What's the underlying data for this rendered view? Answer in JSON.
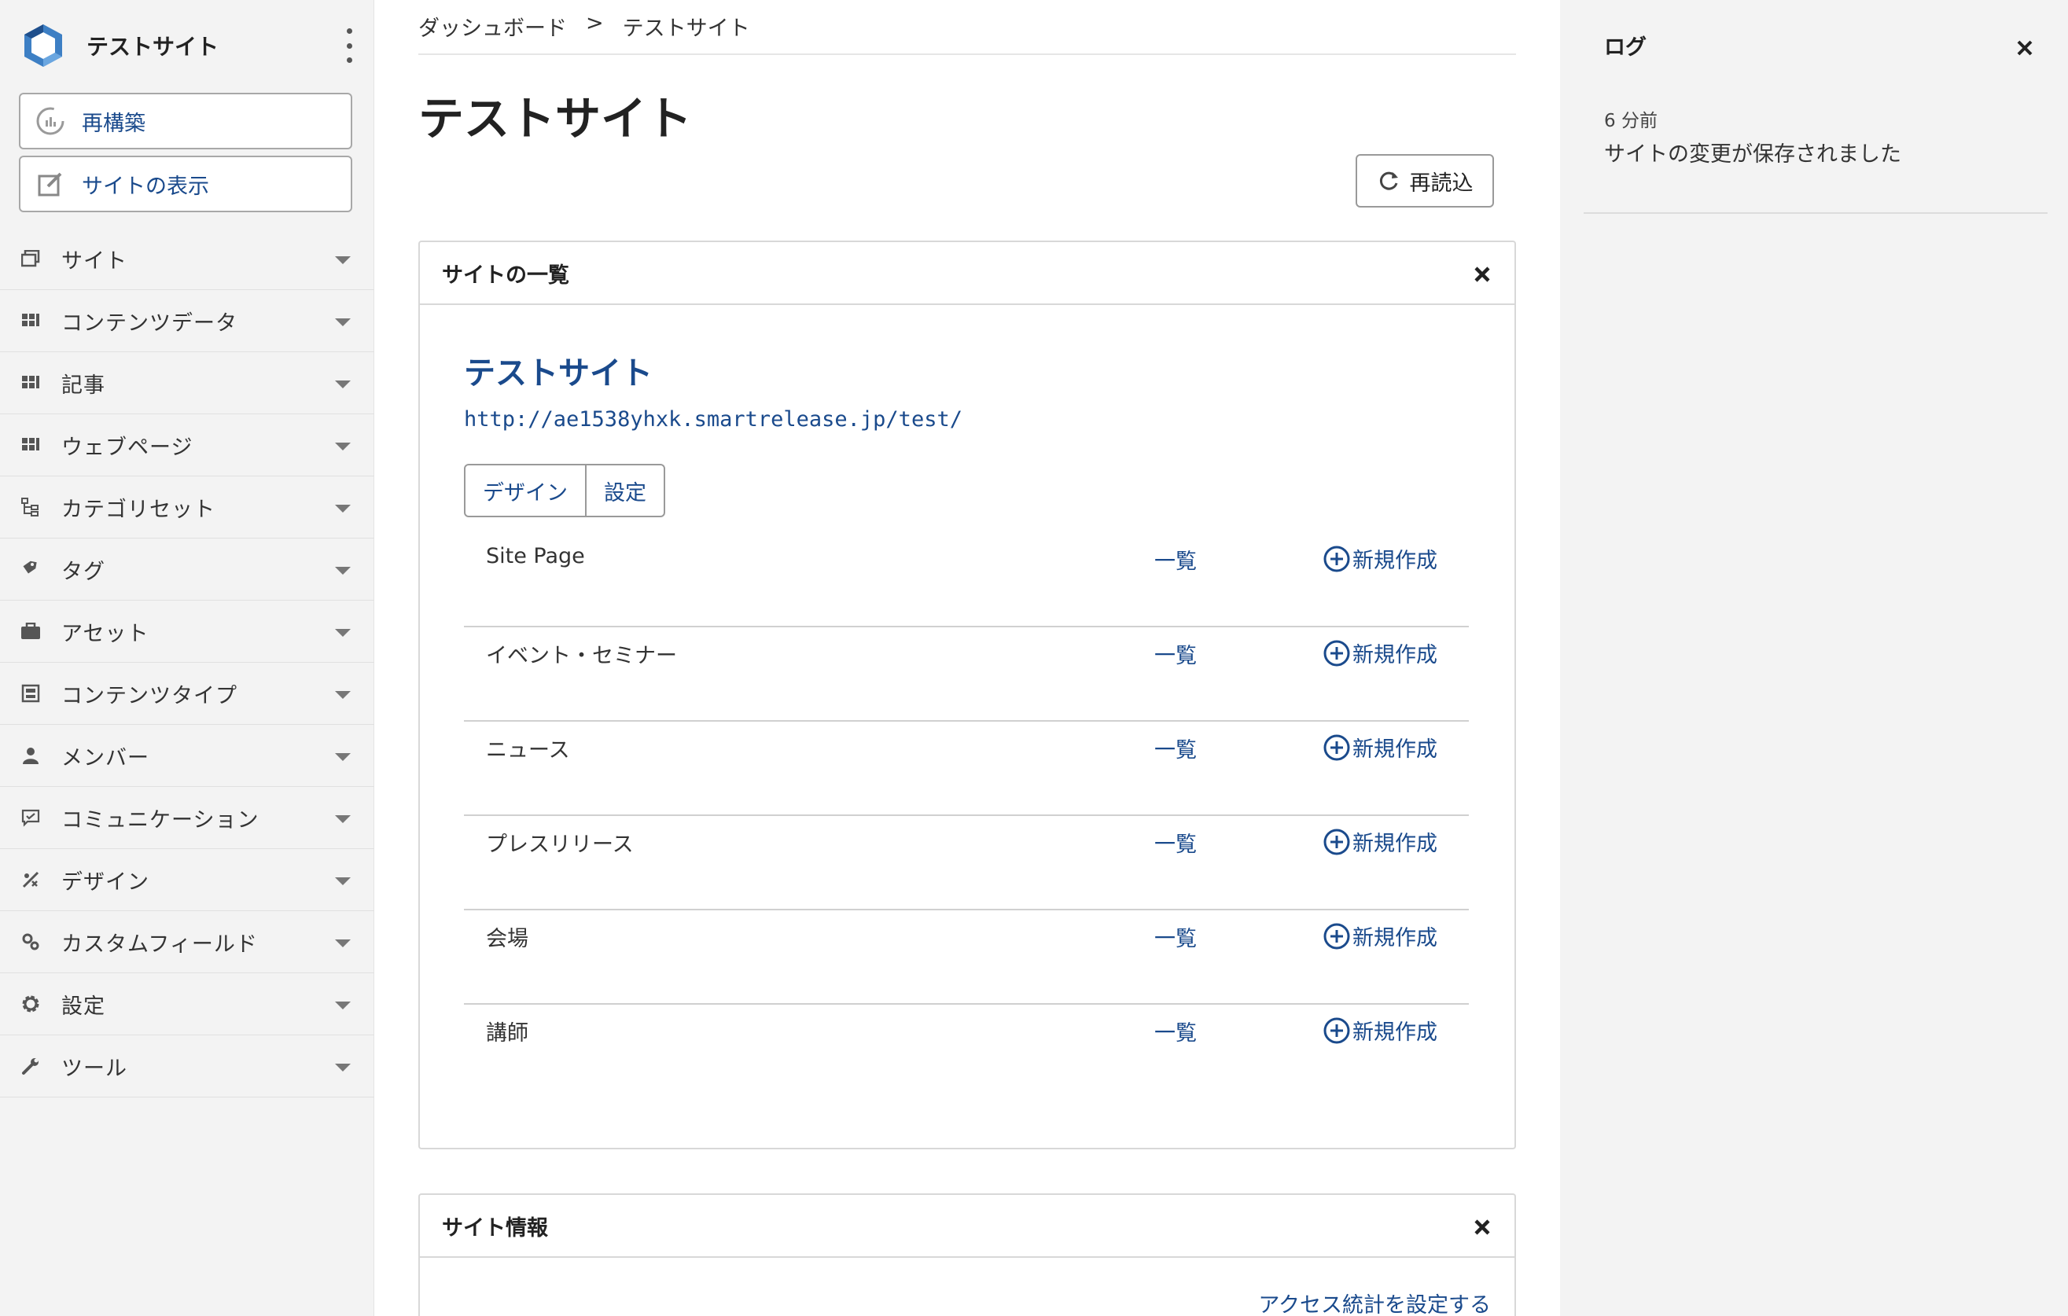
{
  "app": {
    "site_title": "テストサイト"
  },
  "sidebar": {
    "rebuild_label": "再構築",
    "view_site_label": "サイトの表示",
    "items": [
      {
        "label": "サイト",
        "icon": "sites-icon"
      },
      {
        "label": "コンテンツデータ",
        "icon": "content-data-icon"
      },
      {
        "label": "記事",
        "icon": "entries-icon"
      },
      {
        "label": "ウェブページ",
        "icon": "pages-icon"
      },
      {
        "label": "カテゴリセット",
        "icon": "category-set-icon"
      },
      {
        "label": "タグ",
        "icon": "tag-icon"
      },
      {
        "label": "アセット",
        "icon": "asset-icon"
      },
      {
        "label": "コンテンツタイプ",
        "icon": "content-type-icon"
      },
      {
        "label": "メンバー",
        "icon": "member-icon"
      },
      {
        "label": "コミュニケーション",
        "icon": "communication-icon"
      },
      {
        "label": "デザイン",
        "icon": "design-icon"
      },
      {
        "label": "カスタムフィールド",
        "icon": "custom-field-icon"
      },
      {
        "label": "設定",
        "icon": "gear-icon"
      },
      {
        "label": "ツール",
        "icon": "wrench-icon"
      }
    ]
  },
  "breadcrumb": {
    "home": "ダッシュボード",
    "separator": ">",
    "current": "テストサイト"
  },
  "page": {
    "title": "テストサイト",
    "reload_label": "再読込"
  },
  "site_list_widget": {
    "title": "サイトの一覧",
    "site_name": "テストサイト",
    "site_url": "http://ae1538yhxk.smartrelease.jp/test/",
    "design_label": "デザイン",
    "settings_label": "設定",
    "rows": [
      {
        "name": "Site Page",
        "list_label": "一覧",
        "new_label": "新規作成"
      },
      {
        "name": "イベント・セミナー",
        "list_label": "一覧",
        "new_label": "新規作成"
      },
      {
        "name": "ニュース",
        "list_label": "一覧",
        "new_label": "新規作成"
      },
      {
        "name": "プレスリリース",
        "list_label": "一覧",
        "new_label": "新規作成"
      },
      {
        "name": "会場",
        "list_label": "一覧",
        "new_label": "新規作成"
      },
      {
        "name": "講師",
        "list_label": "一覧",
        "new_label": "新規作成"
      }
    ]
  },
  "site_info_widget": {
    "title": "サイト情報",
    "stats_link": "アクセス統計を設定する"
  },
  "log": {
    "title": "ログ",
    "time": "6 分前",
    "message": "サイトの変更が保存されました"
  },
  "colors": {
    "accent": "#1a4a8c",
    "sidebar_bg": "#f3f3f3"
  }
}
